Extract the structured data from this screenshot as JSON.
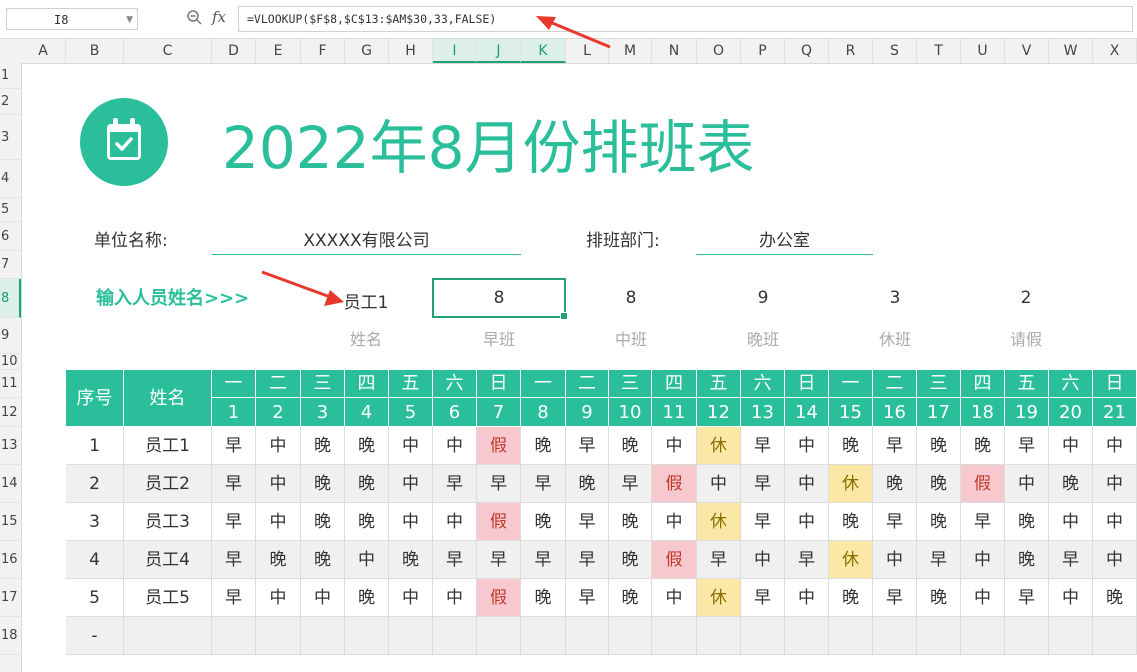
{
  "formula_bar": {
    "name_box": "I8",
    "fx_label": "fx",
    "formula": "=VLOOKUP($F$8,$C$13:$AM$30,33,FALSE)"
  },
  "columns": [
    "A",
    "B",
    "C",
    "D",
    "E",
    "F",
    "G",
    "H",
    "I",
    "J",
    "K",
    "L",
    "M",
    "N",
    "O",
    "P",
    "Q",
    "R",
    "S",
    "T",
    "U",
    "V",
    "W",
    "X"
  ],
  "rows": [
    "1",
    "2",
    "3",
    "4",
    "5",
    "6",
    "7",
    "8",
    "9",
    "10",
    "11",
    "12",
    "13",
    "14",
    "15",
    "16",
    "17",
    "18"
  ],
  "title": "2022年8月份排班表",
  "unit_label": "单位名称:",
  "unit_value": "XXXXX有限公司",
  "dept_label": "排班部门:",
  "dept_value": "办公室",
  "prompt": "输入人员姓名>>>",
  "lookup": {
    "name": "员工1",
    "early": "8",
    "mid": "8",
    "night": "9",
    "rest": "3",
    "leave": "2"
  },
  "lookup_labels": {
    "name": "姓名",
    "early": "早班",
    "mid": "中班",
    "night": "晚班",
    "rest": "休班",
    "leave": "请假"
  },
  "schedule": {
    "header_index": "序号",
    "header_name": "姓名",
    "weekdays": [
      "一",
      "二",
      "三",
      "四",
      "五",
      "六",
      "日",
      "一",
      "二",
      "三",
      "四",
      "五",
      "六",
      "日",
      "一",
      "二",
      "三",
      "四",
      "五",
      "六",
      "日"
    ],
    "dates": [
      "1",
      "2",
      "3",
      "4",
      "5",
      "6",
      "7",
      "8",
      "9",
      "10",
      "11",
      "12",
      "13",
      "14",
      "15",
      "16",
      "17",
      "18",
      "19",
      "20",
      "21"
    ],
    "rows": [
      {
        "idx": "1",
        "name": "员工1",
        "shifts": [
          "早",
          "中",
          "晚",
          "晚",
          "中",
          "中",
          "假",
          "晚",
          "早",
          "晚",
          "中",
          "休",
          "早",
          "中",
          "晚",
          "早",
          "晚",
          "晚",
          "早",
          "中",
          "中"
        ]
      },
      {
        "idx": "2",
        "name": "员工2",
        "shifts": [
          "早",
          "中",
          "晚",
          "晚",
          "中",
          "早",
          "早",
          "早",
          "晚",
          "早",
          "假",
          "中",
          "早",
          "中",
          "休",
          "晚",
          "晚",
          "假",
          "中",
          "晚",
          "中"
        ]
      },
      {
        "idx": "3",
        "name": "员工3",
        "shifts": [
          "早",
          "中",
          "晚",
          "晚",
          "中",
          "中",
          "假",
          "晚",
          "早",
          "晚",
          "中",
          "休",
          "早",
          "中",
          "晚",
          "早",
          "晚",
          "早",
          "晚",
          "中",
          "中"
        ]
      },
      {
        "idx": "4",
        "name": "员工4",
        "shifts": [
          "早",
          "晚",
          "晚",
          "中",
          "晚",
          "早",
          "早",
          "早",
          "早",
          "晚",
          "假",
          "早",
          "中",
          "早",
          "休",
          "中",
          "早",
          "中",
          "晚",
          "早",
          "中"
        ]
      },
      {
        "idx": "5",
        "name": "员工5",
        "shifts": [
          "早",
          "中",
          "中",
          "晚",
          "中",
          "中",
          "假",
          "晚",
          "早",
          "晚",
          "中",
          "休",
          "早",
          "中",
          "晚",
          "早",
          "晚",
          "中",
          "早",
          "中",
          "晚"
        ]
      },
      {
        "idx": "-",
        "name": "",
        "shifts": [
          "",
          "",
          "",
          "",
          "",
          "",
          "",
          "",
          "",
          "",
          "",
          "",
          "",
          "",
          "",
          "",
          "",
          "",
          "",
          "",
          ""
        ]
      }
    ]
  },
  "colors": {
    "accent": "#2abf9a",
    "leave": "#f7c9cf",
    "rest": "#fbe8a6",
    "arrow": "#e8372c"
  }
}
